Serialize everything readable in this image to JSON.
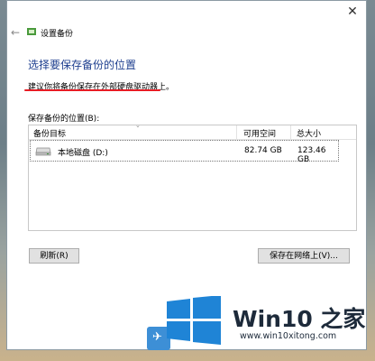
{
  "window": {
    "title": "设置备份",
    "close_glyph": "✕",
    "back_glyph": "←"
  },
  "page": {
    "heading": "选择要保存备份的位置",
    "suggestion": "建议你将备份保存在外部硬盘驱动器上。",
    "location_label": "保存备份的位置(B):"
  },
  "table": {
    "columns": [
      "备份目标",
      "可用空间",
      "总大小"
    ],
    "rows": [
      {
        "name": "本地磁盘 (D:)",
        "free": "82.74 GB",
        "total": "123.46 GB"
      }
    ]
  },
  "buttons": {
    "refresh": "刷新(R)",
    "save_network": "保存在网络上(V)..."
  },
  "watermark": {
    "brand": "Win10 之家",
    "site": "www.win10xitong.com"
  },
  "colors": {
    "heading": "#1e3f8f",
    "underline": "#e81c24",
    "logo_blue": "#1f84d6"
  }
}
